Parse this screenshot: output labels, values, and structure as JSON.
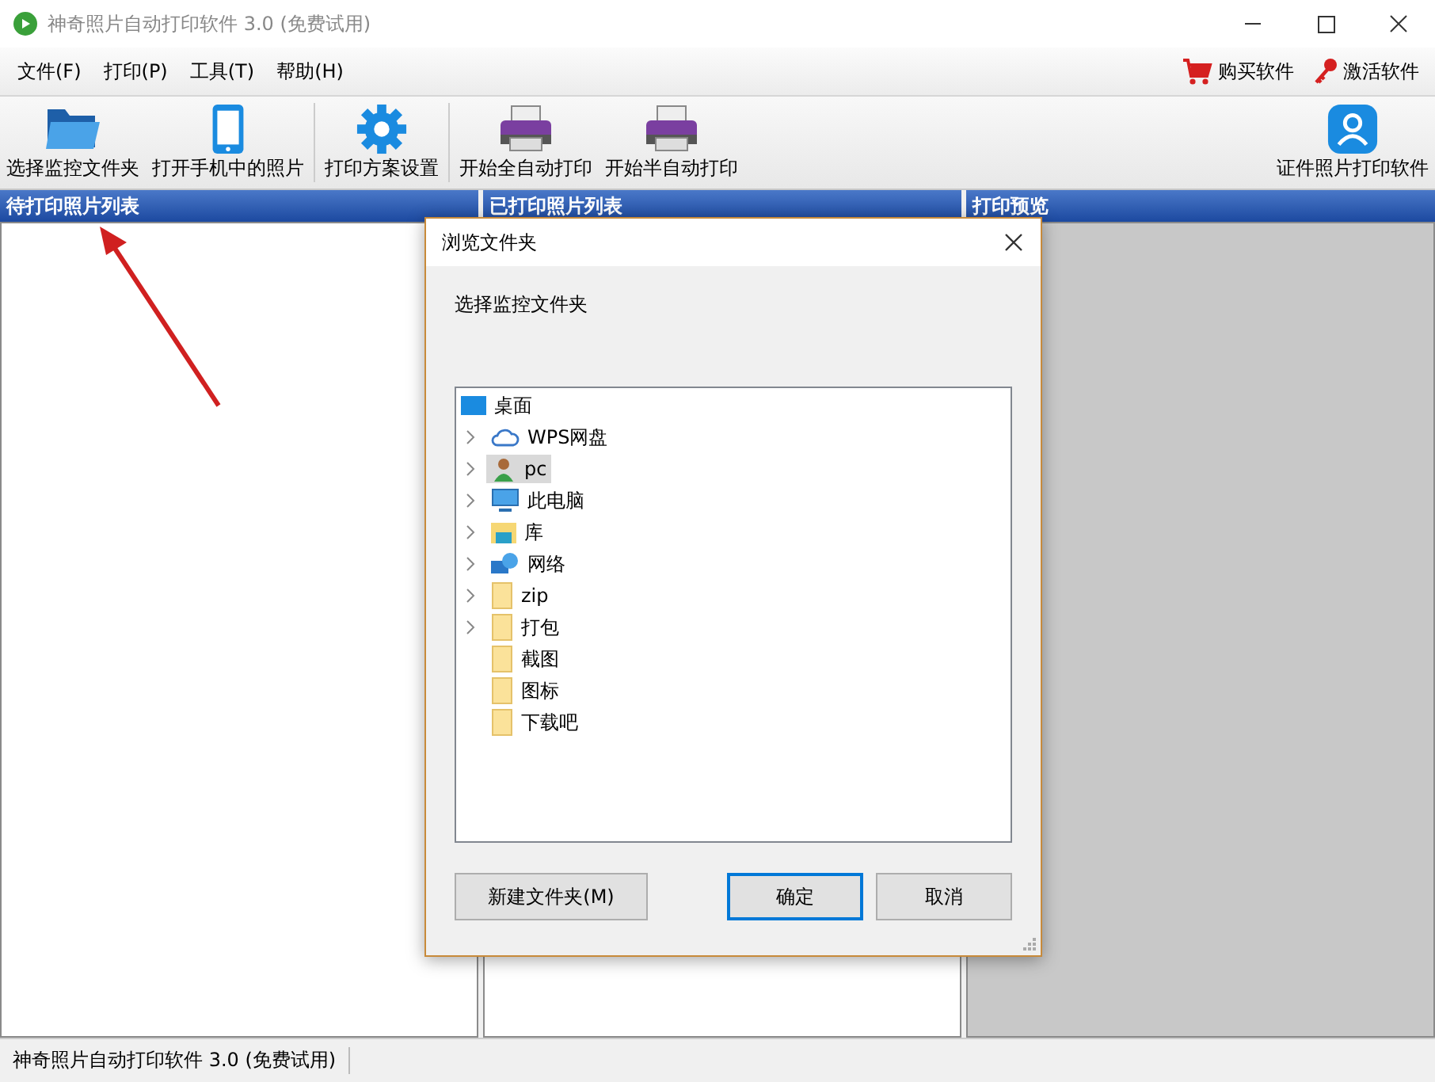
{
  "window": {
    "title": "神奇照片自动打印软件 3.0 (免费试用)"
  },
  "menu": [
    "文件(F)",
    "打印(P)",
    "工具(T)",
    "帮助(H)"
  ],
  "menu_right": [
    {
      "kind": "cart",
      "label": "购买软件"
    },
    {
      "kind": "key",
      "label": "激活软件"
    }
  ],
  "toolbar": [
    {
      "kind": "folder",
      "label": "选择监控文件夹"
    },
    {
      "kind": "phone",
      "label": "打开手机中的照片"
    },
    {
      "kind": "gear",
      "label": "打印方案设置"
    },
    {
      "kind": "printer",
      "label": "开始全自动打印"
    },
    {
      "kind": "printer",
      "label": "开始半自动打印"
    }
  ],
  "toolbar_right": {
    "kind": "person",
    "label": "证件照片打印软件"
  },
  "panels": [
    {
      "title": "待打印照片列表",
      "kind": "list"
    },
    {
      "title": "已打印照片列表",
      "kind": "list"
    },
    {
      "title": "打印预览",
      "kind": "preview"
    }
  ],
  "dialog": {
    "title": "浏览文件夹",
    "prompt": "选择监控文件夹",
    "tree": {
      "label": "桌面",
      "kind": "desktop",
      "selected": false,
      "children": [
        {
          "label": "WPS网盘",
          "kind": "cloud",
          "expandable": true,
          "selected": false
        },
        {
          "label": "pc",
          "kind": "user",
          "expandable": true,
          "selected": true
        },
        {
          "label": "此电脑",
          "kind": "computer",
          "expandable": true,
          "selected": false
        },
        {
          "label": "库",
          "kind": "library",
          "expandable": true,
          "selected": false
        },
        {
          "label": "网络",
          "kind": "network",
          "expandable": true,
          "selected": false
        },
        {
          "label": "zip",
          "kind": "folder",
          "expandable": true,
          "selected": false
        },
        {
          "label": "打包",
          "kind": "folder",
          "expandable": true,
          "selected": false
        },
        {
          "label": "截图",
          "kind": "folder",
          "expandable": false,
          "selected": false
        },
        {
          "label": "图标",
          "kind": "folder",
          "expandable": false,
          "selected": false
        },
        {
          "label": "下载吧",
          "kind": "folder",
          "expandable": false,
          "selected": false
        }
      ]
    },
    "buttons": [
      {
        "label": "新建文件夹(M)",
        "kind": "secondary"
      },
      {
        "label": "确定",
        "kind": "default"
      },
      {
        "label": "取消",
        "kind": "normal"
      }
    ]
  },
  "status_bar": [
    "神奇照片自动打印软件 3.0 (免费试用)"
  ]
}
